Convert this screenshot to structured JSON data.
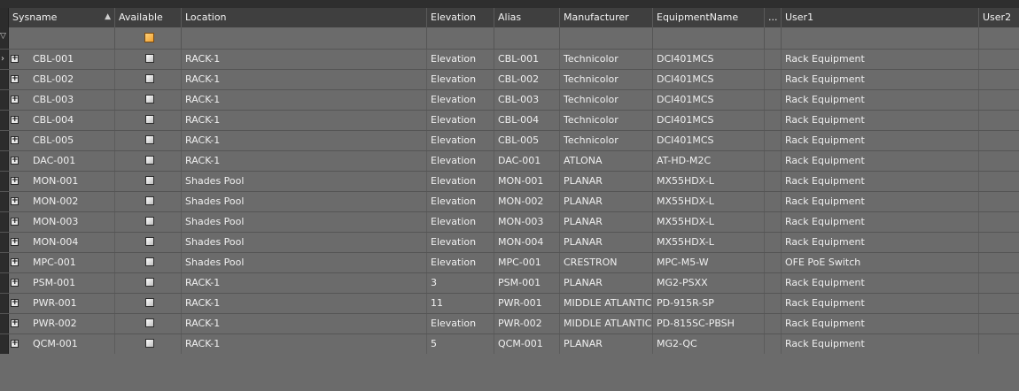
{
  "columns": [
    {
      "key": "sysname",
      "label": "Sysname"
    },
    {
      "key": "available",
      "label": "Available"
    },
    {
      "key": "location",
      "label": "Location"
    },
    {
      "key": "elevation",
      "label": "Elevation"
    },
    {
      "key": "alias",
      "label": "Alias"
    },
    {
      "key": "manufacturer",
      "label": "Manufacturer"
    },
    {
      "key": "equipment",
      "label": "EquipmentName"
    },
    {
      "key": "more",
      "label": "..."
    },
    {
      "key": "user1",
      "label": "User1"
    },
    {
      "key": "user2",
      "label": "User2"
    }
  ],
  "sort": {
    "column": "sysname",
    "direction": "ascending",
    "icon": "sort-ascending-icon"
  },
  "rows": [
    {
      "sysname": "CBL-001",
      "location": "RACK-1",
      "elevation": "Elevation",
      "alias": "CBL-001",
      "manufacturer": "Technicolor",
      "equipment": "DCI401MCS",
      "user1": "Rack Equipment",
      "user2": ""
    },
    {
      "sysname": "CBL-002",
      "location": "RACK-1",
      "elevation": "Elevation",
      "alias": "CBL-002",
      "manufacturer": "Technicolor",
      "equipment": "DCI401MCS",
      "user1": "Rack Equipment",
      "user2": ""
    },
    {
      "sysname": "CBL-003",
      "location": "RACK-1",
      "elevation": "Elevation",
      "alias": "CBL-003",
      "manufacturer": "Technicolor",
      "equipment": "DCI401MCS",
      "user1": "Rack Equipment",
      "user2": ""
    },
    {
      "sysname": "CBL-004",
      "location": "RACK-1",
      "elevation": "Elevation",
      "alias": "CBL-004",
      "manufacturer": "Technicolor",
      "equipment": "DCI401MCS",
      "user1": "Rack Equipment",
      "user2": ""
    },
    {
      "sysname": "CBL-005",
      "location": "RACK-1",
      "elevation": "Elevation",
      "alias": "CBL-005",
      "manufacturer": "Technicolor",
      "equipment": "DCI401MCS",
      "user1": "Rack Equipment",
      "user2": ""
    },
    {
      "sysname": "DAC-001",
      "location": "RACK-1",
      "elevation": "Elevation",
      "alias": "DAC-001",
      "manufacturer": "ATLONA",
      "equipment": "AT-HD-M2C",
      "user1": "Rack Equipment",
      "user2": ""
    },
    {
      "sysname": "MON-001",
      "location": "Shades Pool",
      "elevation": "Elevation",
      "alias": "MON-001",
      "manufacturer": "PLANAR",
      "equipment": "MX55HDX-L",
      "user1": "Rack Equipment",
      "user2": ""
    },
    {
      "sysname": "MON-002",
      "location": "Shades Pool",
      "elevation": "Elevation",
      "alias": "MON-002",
      "manufacturer": "PLANAR",
      "equipment": "MX55HDX-L",
      "user1": "Rack Equipment",
      "user2": ""
    },
    {
      "sysname": "MON-003",
      "location": "Shades Pool",
      "elevation": "Elevation",
      "alias": "MON-003",
      "manufacturer": "PLANAR",
      "equipment": "MX55HDX-L",
      "user1": "Rack Equipment",
      "user2": ""
    },
    {
      "sysname": "MON-004",
      "location": "Shades Pool",
      "elevation": "Elevation",
      "alias": "MON-004",
      "manufacturer": "PLANAR",
      "equipment": "MX55HDX-L",
      "user1": "Rack Equipment",
      "user2": ""
    },
    {
      "sysname": "MPC-001",
      "location": "Shades Pool",
      "elevation": "Elevation",
      "alias": "MPC-001",
      "manufacturer": "CRESTRON",
      "equipment": "MPC-M5-W",
      "user1": "OFE PoE Switch",
      "user2": ""
    },
    {
      "sysname": "PSM-001",
      "location": "RACK-1",
      "elevation": "3",
      "alias": "PSM-001",
      "manufacturer": "PLANAR",
      "equipment": "MG2-PSXX",
      "user1": "Rack Equipment",
      "user2": ""
    },
    {
      "sysname": "PWR-001",
      "location": "RACK-1",
      "elevation": "11",
      "alias": "PWR-001",
      "manufacturer": "MIDDLE ATLANTIC",
      "equipment": "PD-915R-SP",
      "user1": "Rack Equipment",
      "user2": ""
    },
    {
      "sysname": "PWR-002",
      "location": "RACK-1",
      "elevation": "Elevation",
      "alias": "PWR-002",
      "manufacturer": "MIDDLE ATLANTIC",
      "equipment": "PD-815SC-PBSH",
      "user1": "Rack Equipment",
      "user2": ""
    },
    {
      "sysname": "QCM-001",
      "location": "RACK-1",
      "elevation": "5",
      "alias": "QCM-001",
      "manufacturer": "PLANAR",
      "equipment": "MG2-QC",
      "user1": "Rack Equipment",
      "user2": ""
    }
  ]
}
